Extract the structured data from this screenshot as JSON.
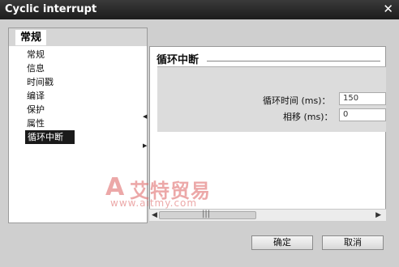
{
  "window": {
    "title": "Cyclic interrupt"
  },
  "left_panel": {
    "header_tab": "常规",
    "items": [
      "常规",
      "信息",
      "时间戳",
      "编译",
      "保护",
      "属性",
      "循环中断"
    ],
    "selected_index": 6
  },
  "main": {
    "section_title": "循环中断",
    "fields": [
      {
        "label": "循环时间 (ms)：",
        "value": "150"
      },
      {
        "label": "相移 (ms)：",
        "value": "0"
      }
    ]
  },
  "buttons": {
    "ok": "确定",
    "cancel": "取消"
  },
  "watermark": {
    "name": "艾特贸易",
    "url": "www.aitmy.com"
  },
  "colors": {
    "titlebar": "#1c1c1c",
    "selected_bg": "#1a1a1a",
    "watermark": "#e07070"
  }
}
